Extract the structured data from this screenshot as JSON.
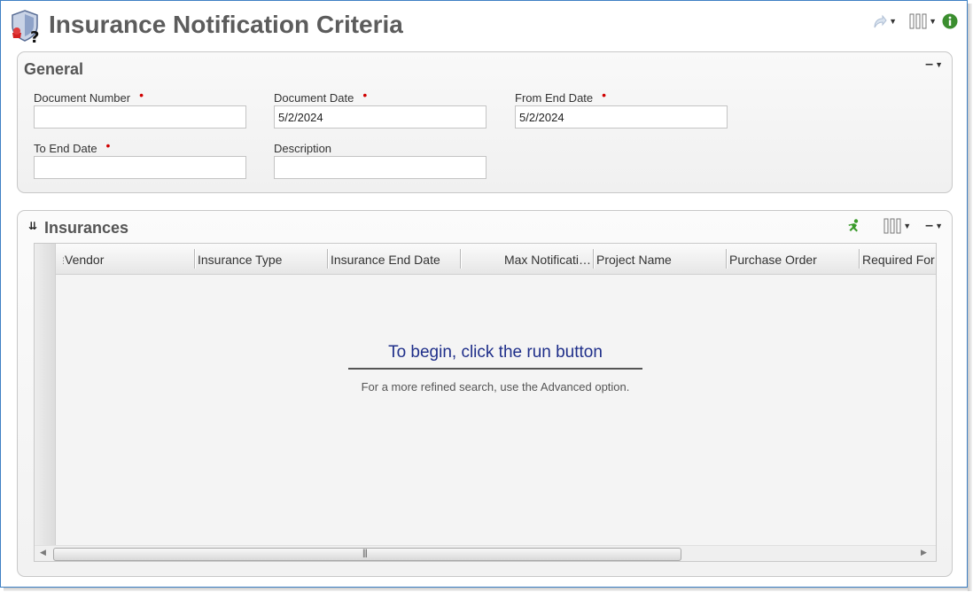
{
  "header": {
    "title": "Insurance Notification Criteria",
    "icon": "insurance-shield-icon"
  },
  "general": {
    "title": "General",
    "fields": {
      "document_number": {
        "label": "Document Number",
        "value": "",
        "required": true
      },
      "document_date": {
        "label": "Document Date",
        "value": "5/2/2024",
        "required": true
      },
      "from_end_date": {
        "label": "From End Date",
        "value": "5/2/2024",
        "required": true
      },
      "to_end_date": {
        "label": "To End Date",
        "value": "",
        "required": true
      },
      "description": {
        "label": "Description",
        "value": "",
        "required": false
      }
    },
    "required_marker": "•"
  },
  "insurances": {
    "title": "Insurances",
    "columns": [
      "Vendor",
      "Insurance Type",
      "Insurance End Date",
      "Max Notificati…",
      "Project Name",
      "Purchase Order",
      "Required For"
    ],
    "empty_title": "To begin, click the run button",
    "empty_subtitle": "For a more refined search, use the Advanced option."
  },
  "colors": {
    "accent_border": "#3e80c4",
    "title_text": "#5c5c5c",
    "empty_title": "#1f2f8a",
    "required": "#d00000",
    "run_icon": "#3a9a2a"
  }
}
